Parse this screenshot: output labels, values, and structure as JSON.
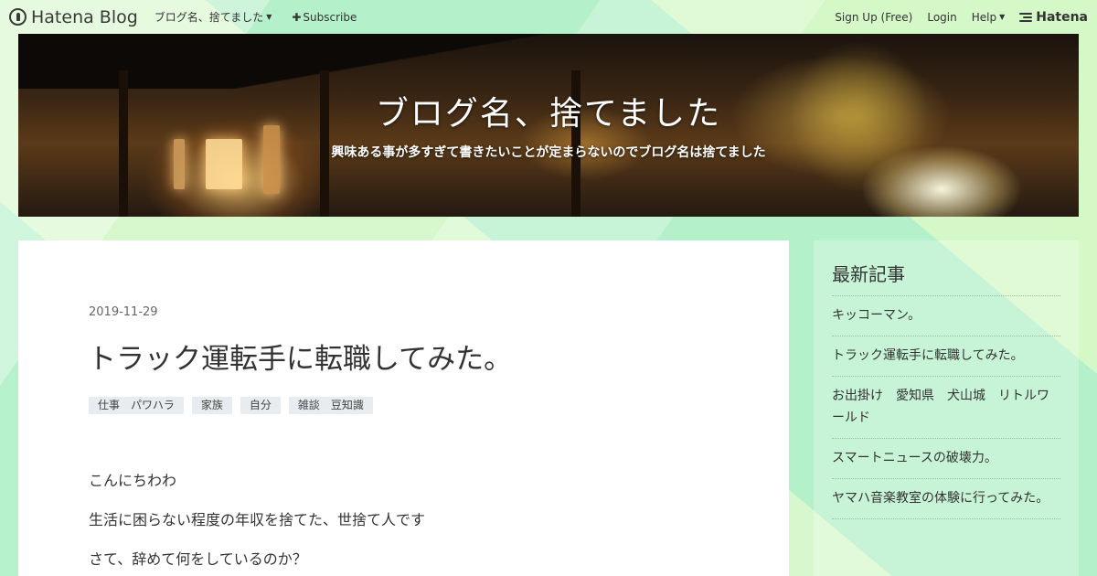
{
  "globalbar": {
    "logo_text": "Hatena Blog",
    "blog_menu": "ブログ名、捨てました",
    "subscribe": "Subscribe",
    "signup": "Sign Up (Free)",
    "login": "Login",
    "help": "Help",
    "hatena": "Hatena"
  },
  "banner": {
    "title": "ブログ名、捨てました",
    "description": "興味ある事が多すぎて書きたいことが定まらないのでブログ名は捨てました"
  },
  "article": {
    "date": "2019-11-29",
    "title": "トラック運転手に転職してみた。",
    "categories": [
      "仕事　パワハラ",
      "家族",
      "自分",
      "雑談　豆知識"
    ],
    "paragraphs": [
      "こんにちわわ",
      "生活に困らない程度の年収を捨てた、世捨て人です",
      "さて、辞めて何をしているのか？"
    ]
  },
  "sidebar": {
    "title": "最新記事",
    "items": [
      "キッコーマン。",
      "トラック運転手に転職してみた。",
      "お出掛け　愛知県　犬山城　リトルワールド",
      "スマートニュースの破壊力。",
      "ヤマハ音楽教室の体験に行ってみた。"
    ]
  }
}
